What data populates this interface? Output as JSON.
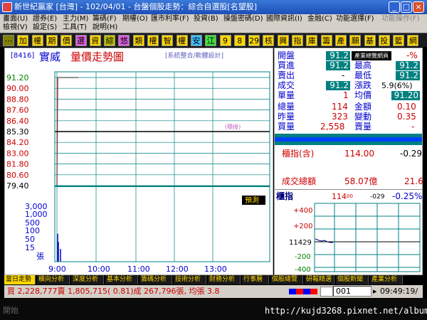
{
  "window": {
    "title": "新世紀贏家 [台灣] - 102/04/01 - 台盤個股走勢：綜合自選股[名望股]",
    "minimize_glyph": "_",
    "maximize_glyph": "□",
    "close_glyph": "×"
  },
  "menu": {
    "row1": [
      "畫面(U)",
      "證券(E)",
      "主力(M)",
      "籌碼(F)",
      "期權(O)",
      "匯市利率(F)",
      "投資(B)",
      "操盤密碼(D)",
      "國際資訊(I)",
      "金融(C)",
      "功能選擇(F)",
      "功能操作(F)"
    ],
    "row2": [
      "檢視(V)",
      "設定(S)",
      "工具(T)",
      "說明(H)"
    ]
  },
  "toolbar": {
    "buttons": [
      "⋯",
      "加",
      "權",
      "期",
      "價",
      "選",
      "資",
      "綜",
      "悠",
      "類",
      "權",
      "智",
      "權",
      "安",
      "江",
      "9",
      "8",
      "29",
      "核",
      "興",
      "指",
      "庫",
      "籌",
      "產",
      "願",
      "基",
      "投",
      "籃",
      "網"
    ],
    "colors": [
      "#808000",
      "#ffd700",
      "#ffd700",
      "#ffd700",
      "#ffd700",
      "#e060e0",
      "#ffd700",
      "#c0c000",
      "#e060e0",
      "#ffd700",
      "#ffd700",
      "#ffd700",
      "#ffd700",
      "#40c0ff",
      "#40e040",
      "#ffd700",
      "#ffd700",
      "#ffd700",
      "#ffd700",
      "#ffd700",
      "#ffd700",
      "#ffd700",
      "#ffd700",
      "#ffd700",
      "#ffd700",
      "#ffd700",
      "#ffd700",
      "#ffd700",
      "#ffd700"
    ]
  },
  "chart": {
    "code": "[8416]",
    "name": "實威",
    "title": "量價走勢圖",
    "subtitle": "[系統整合/軟體設計]",
    "price_ticks": [
      "91.20",
      "90.00",
      "88.80",
      "87.60",
      "86.40",
      "85.30",
      "84.20",
      "83.00",
      "81.80",
      "80.60",
      "79.40"
    ],
    "volume_ticks": [
      "3,000",
      "1,000",
      "500",
      "100",
      "50",
      "15",
      "張"
    ],
    "time_ticks": [
      "9:00",
      "10:00",
      "11:00",
      "12:00",
      "13:00"
    ],
    "limit_down_label": "(積接)",
    "button_label": "預測"
  },
  "chart_data": {
    "type": "line",
    "title": "量價走勢圖",
    "x_ticks": [
      "9:00",
      "10:00",
      "11:00",
      "12:00",
      "13:00"
    ],
    "price": {
      "ylim": [
        79.4,
        91.2
      ],
      "reference": 85.3,
      "points": [
        {
          "x": "9:00",
          "y": 79.4
        },
        {
          "x": "9:01",
          "y": 91.2
        },
        {
          "x": "9:30",
          "y": 91.2
        }
      ]
    },
    "avg_price": {
      "points": [
        {
          "x": "9:01",
          "y": 85.3
        },
        {
          "x": "9:40",
          "y": 85.3
        }
      ]
    },
    "volume": {
      "points": [
        {
          "x": "9:01",
          "y": 50
        },
        {
          "x": "9:02",
          "y": 15
        },
        {
          "x": "9:05",
          "y": 5
        }
      ]
    }
  },
  "quote": {
    "open_lbl": "開盤",
    "open_val": "91.2",
    "bid_lbl": "買進",
    "bid_val": "91.2",
    "high_lbl": "最高",
    "high_val": "91.2",
    "ask_lbl": "賣出",
    "ask_val": "-",
    "low_lbl": "最低",
    "low_val": "91.2",
    "deal_lbl": "成交",
    "deal_val": "91.2",
    "chg_lbl": "漲跌",
    "chg_val": "5.9(6%)",
    "pct_val": "-%",
    "single_lbl": "單量",
    "single_val": "1",
    "avg_lbl": "均價",
    "avg_val": "91.20",
    "total_lbl": "總量",
    "total_val": "114",
    "amount_lbl": "金額",
    "amount_val": "0.10",
    "prev_lbl": "昨量",
    "prev_val": "323",
    "turnover_lbl": "變動",
    "turnover_val": "0.35",
    "buyvol_lbl": "買量",
    "buyvol_val": "2,558",
    "sellvol_lbl": "賣量",
    "sellvol_val": "-",
    "popup": "產業總覽網頁"
  },
  "index": {
    "counter_lbl": "櫃指(含)",
    "counter_val": "114.00",
    "counter_chg": "-0.29",
    "volume_lbl": "成交總額",
    "volume_val": "58.07億",
    "volume_chg": "21.6",
    "head_lbl": "櫃指",
    "head_val": "114",
    "head_val_sup": "00",
    "head_chg": "-029",
    "head_pct": "-0.25%",
    "ticks": [
      "+400",
      "+200",
      "11429",
      "-200",
      "-400"
    ]
  },
  "tabs": [
    "當日走勢",
    "橫向分析",
    "深度分析",
    "基本分析",
    "籌碼分析",
    "技術分析",
    "財務分析",
    "行事曆",
    "個股總覽",
    "研報精選",
    "個股新聞",
    "產業分析"
  ],
  "status": {
    "text": "買 2,228,777賣 1,805,715( 0.81)成 267,796張, 均張 3.8",
    "field": "001",
    "time": "09:49:19/"
  },
  "taskbar": {
    "label": "開始",
    "url": "http://kujd3268.pixnet.net/album"
  }
}
